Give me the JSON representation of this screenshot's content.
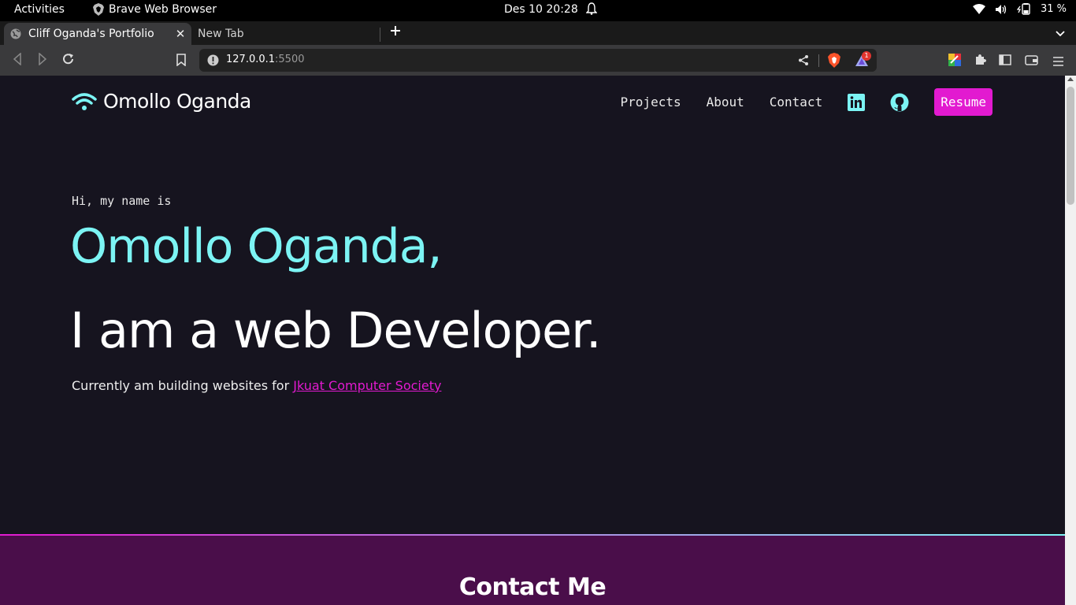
{
  "system": {
    "activities": "Activities",
    "app_name": "Brave Web Browser",
    "clock": "Des 10  20:28",
    "battery": "31 %"
  },
  "tabs": [
    {
      "title": "Cliff Oganda's Portfolio",
      "active": true
    },
    {
      "title": "New Tab",
      "active": false
    }
  ],
  "toolbar": {
    "url_host": "127.0.0.1",
    "url_port": ":5500",
    "rewards_badge": "1"
  },
  "site": {
    "brand": "Omollo Oganda",
    "nav": [
      "Projects",
      "About",
      "Contact"
    ],
    "resume_label": "Resume",
    "greeting": "Hi, my name is",
    "name": "Omollo Oganda,",
    "role": "I am a web Developer.",
    "tagline_prefix": "Currently am building websites for ",
    "tagline_link": "Jkuat Computer Society",
    "contact_heading": "Contact Me"
  },
  "colors": {
    "accent_cyan": "#7cf4f4",
    "accent_magenta": "#e21ad0",
    "background": "#16141f",
    "contact_bg": "#4a0e4a"
  }
}
